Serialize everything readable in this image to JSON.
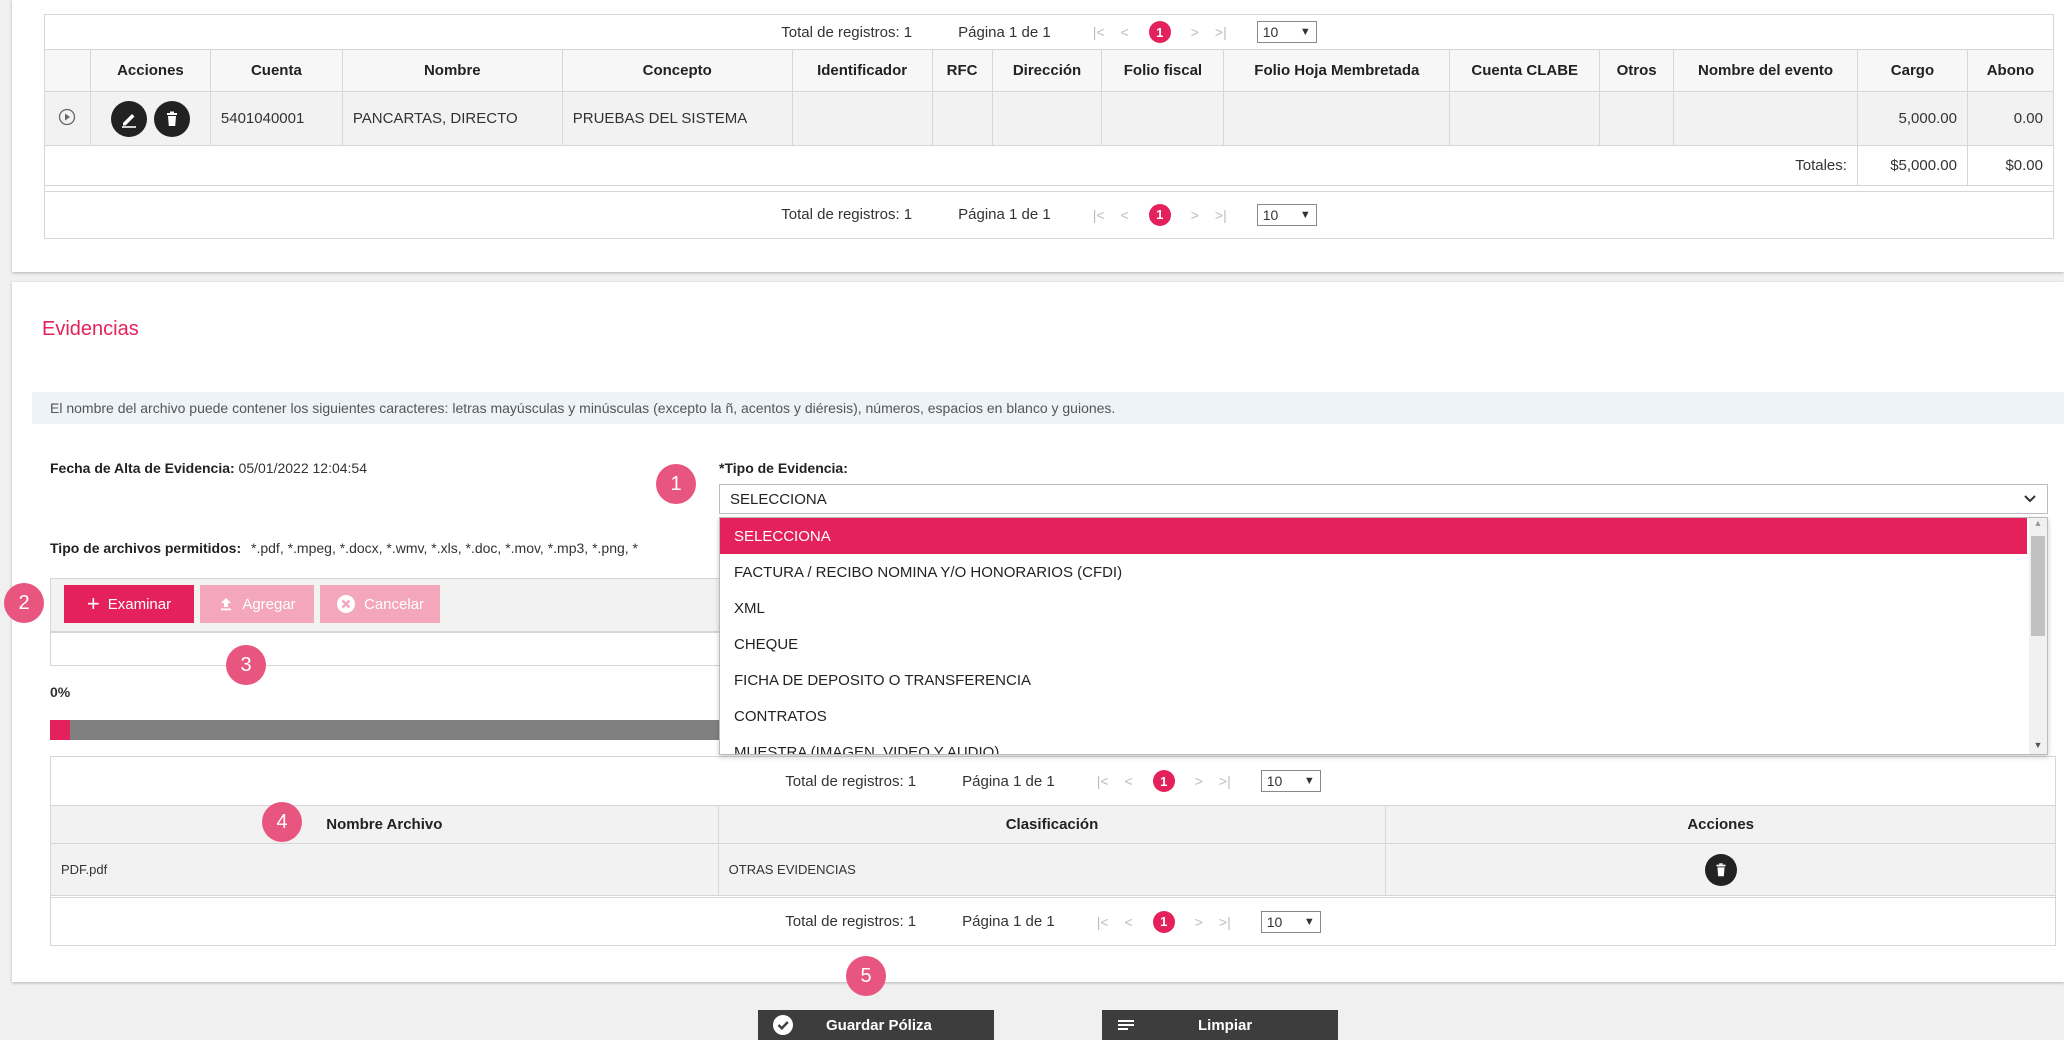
{
  "pager": {
    "total_text": "Total de registros: 1",
    "page_text": "Página 1 de 1",
    "first": "|<",
    "prev": "<",
    "current": "1",
    "next": ">",
    "last": ">|",
    "size": "10"
  },
  "polizas_table": {
    "columns": [
      "",
      "Acciones",
      "Cuenta",
      "Nombre",
      "Concepto",
      "Identificador",
      "RFC",
      "Dirección",
      "Folio fiscal",
      "Folio Hoja Membretada",
      "Cuenta CLABE",
      "Otros",
      "Nombre del evento",
      "Cargo",
      "Abono"
    ],
    "row": {
      "cuenta": "5401040001",
      "nombre": "PANCARTAS, DIRECTO",
      "concepto": "PRUEBAS DEL SISTEMA",
      "identificador": "",
      "rfc": "",
      "direccion": "",
      "folio_fiscal": "",
      "folio_hoja": "",
      "cuenta_clabe": "",
      "otros": "",
      "nombre_evento": "",
      "cargo": "5,000.00",
      "abono": "0.00"
    },
    "totals_label": "Totales:",
    "total_cargo": "$5,000.00",
    "total_abono": "$0.00"
  },
  "evidencias": {
    "title": "Evidencias",
    "info": "El nombre del archivo puede contener los siguientes caracteres: letras mayúsculas y minúsculas (excepto la ñ, acentos y diéresis), números, espacios en blanco y guiones.",
    "fecha_label": "Fecha de Alta de Evidencia:",
    "fecha_value": "05/01/2022 12:04:54",
    "tipo_label": "*Tipo de Evidencia:",
    "tipo_selected": "SELECCIONA",
    "tipos_archivos_label": "Tipo de archivos permitidos:",
    "tipos_archivos_value": "*.pdf, *.mpeg, *.docx, *.wmv, *.xls, *.doc, *.mov, *.mp3, *.png, *",
    "options": [
      "SELECCIONA",
      "FACTURA / RECIBO NOMINA Y/O HONORARIOS (CFDI)",
      "XML",
      "CHEQUE",
      "FICHA DE DEPOSITO O TRANSFERENCIA",
      "CONTRATOS",
      "MUESTRA (IMAGEN, VIDEO Y AUDIO)"
    ],
    "btn_examinar": "Examinar",
    "btn_agregar": "Agregar",
    "btn_cancelar": "Cancelar",
    "progress_text": "0%",
    "progress_fraction": 0.0,
    "files_table": {
      "columns": [
        "Nombre Archivo",
        "Clasificación",
        "Acciones"
      ],
      "row": {
        "nombre": "PDF.pdf",
        "clasificacion": "OTRAS EVIDENCIAS"
      }
    }
  },
  "badges": [
    "1",
    "2",
    "3",
    "4",
    "5"
  ],
  "footer": {
    "guardar": "Guardar Póliza",
    "limpiar": "Limpiar"
  },
  "colors": {
    "accent": "#e5215c",
    "badge": "#e8557e",
    "dark_button": "#3d3d3d"
  },
  "icons": [
    "play-circle-icon",
    "edit-icon",
    "trash-icon",
    "plus-icon",
    "upload-icon",
    "cancel-circle-icon",
    "check-circle-icon",
    "lines-icon",
    "chevron-down-icon"
  ]
}
